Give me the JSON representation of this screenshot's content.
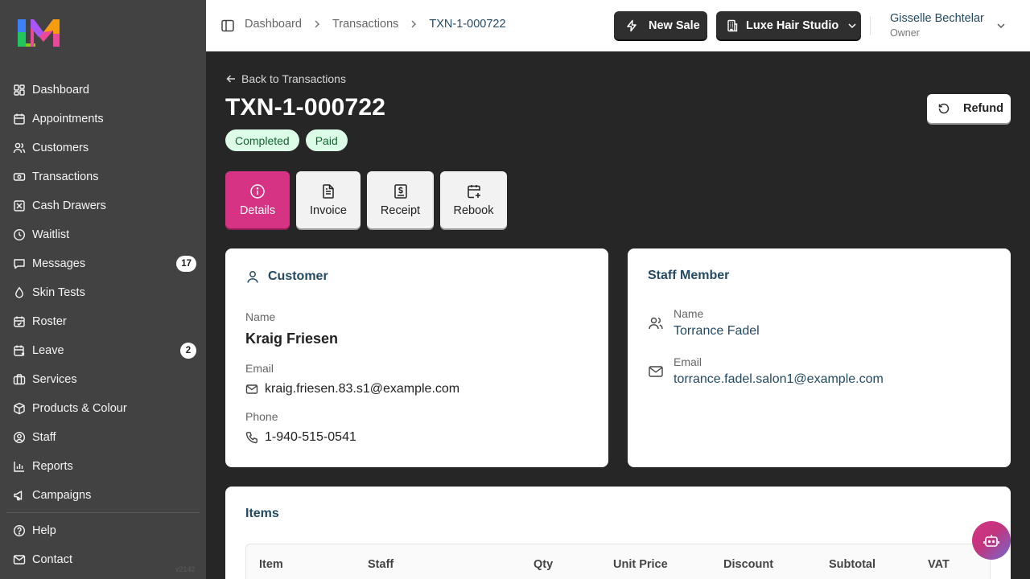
{
  "app": {
    "version": "v2142"
  },
  "sidebar": {
    "items": [
      {
        "label": "Dashboard",
        "icon": "dashboard-icon"
      },
      {
        "label": "Appointments",
        "icon": "calendar-icon"
      },
      {
        "label": "Customers",
        "icon": "users-icon"
      },
      {
        "label": "Transactions",
        "icon": "banknote-icon"
      },
      {
        "label": "Cash Drawers",
        "icon": "cash-drawer-icon"
      },
      {
        "label": "Waitlist",
        "icon": "clock-icon"
      },
      {
        "label": "Messages",
        "icon": "message-icon",
        "badge": "17"
      },
      {
        "label": "Skin Tests",
        "icon": "droplet-icon"
      },
      {
        "label": "Roster",
        "icon": "roster-icon"
      },
      {
        "label": "Leave",
        "icon": "leave-icon",
        "badge": "2"
      },
      {
        "label": "Services",
        "icon": "briefcase-icon"
      },
      {
        "label": "Products & Colour",
        "icon": "package-icon"
      },
      {
        "label": "Staff",
        "icon": "user-circle-icon"
      },
      {
        "label": "Reports",
        "icon": "bar-chart-icon"
      },
      {
        "label": "Campaigns",
        "icon": "megaphone-icon"
      }
    ],
    "bottom_items": [
      {
        "label": "Help",
        "icon": "help-icon"
      },
      {
        "label": "Contact",
        "icon": "mail-icon"
      }
    ]
  },
  "header": {
    "breadcrumbs": [
      "Dashboard",
      "Transactions",
      "TXN-1-000722"
    ],
    "new_sale_label": "New Sale",
    "studio_label": "Luxe Hair Studio",
    "user_name": "Gisselle Bechtelar",
    "user_role": "Owner"
  },
  "page": {
    "back_label": "Back to Transactions",
    "title": "TXN-1-000722",
    "badges": [
      "Completed",
      "Paid"
    ],
    "refund_label": "Refund",
    "tabs": [
      {
        "label": "Details",
        "icon": "info-icon",
        "active": true
      },
      {
        "label": "Invoice",
        "icon": "file-text-icon",
        "active": false
      },
      {
        "label": "Receipt",
        "icon": "receipt-icon",
        "active": false
      },
      {
        "label": "Rebook",
        "icon": "calendar-plus-icon",
        "active": false
      }
    ]
  },
  "customer": {
    "title": "Customer",
    "name_label": "Name",
    "name": "Kraig Friesen",
    "email_label": "Email",
    "email": "kraig.friesen.83.s1@example.com",
    "phone_label": "Phone",
    "phone": "1-940-515-0541"
  },
  "staff": {
    "title": "Staff Member",
    "name_label": "Name",
    "name": "Torrance Fadel",
    "email_label": "Email",
    "email": "torrance.fadel.salon1@example.com"
  },
  "items": {
    "title": "Items",
    "columns": [
      "Item",
      "Staff",
      "Qty",
      "Unit Price",
      "Discount",
      "Subtotal",
      "VAT"
    ]
  },
  "colors": {
    "accent": "#d63384",
    "sidebar_bg": "#424242",
    "page_bg": "#262626",
    "link": "#234a63",
    "badge_bg": "#dcfce7",
    "badge_text": "#166534"
  }
}
